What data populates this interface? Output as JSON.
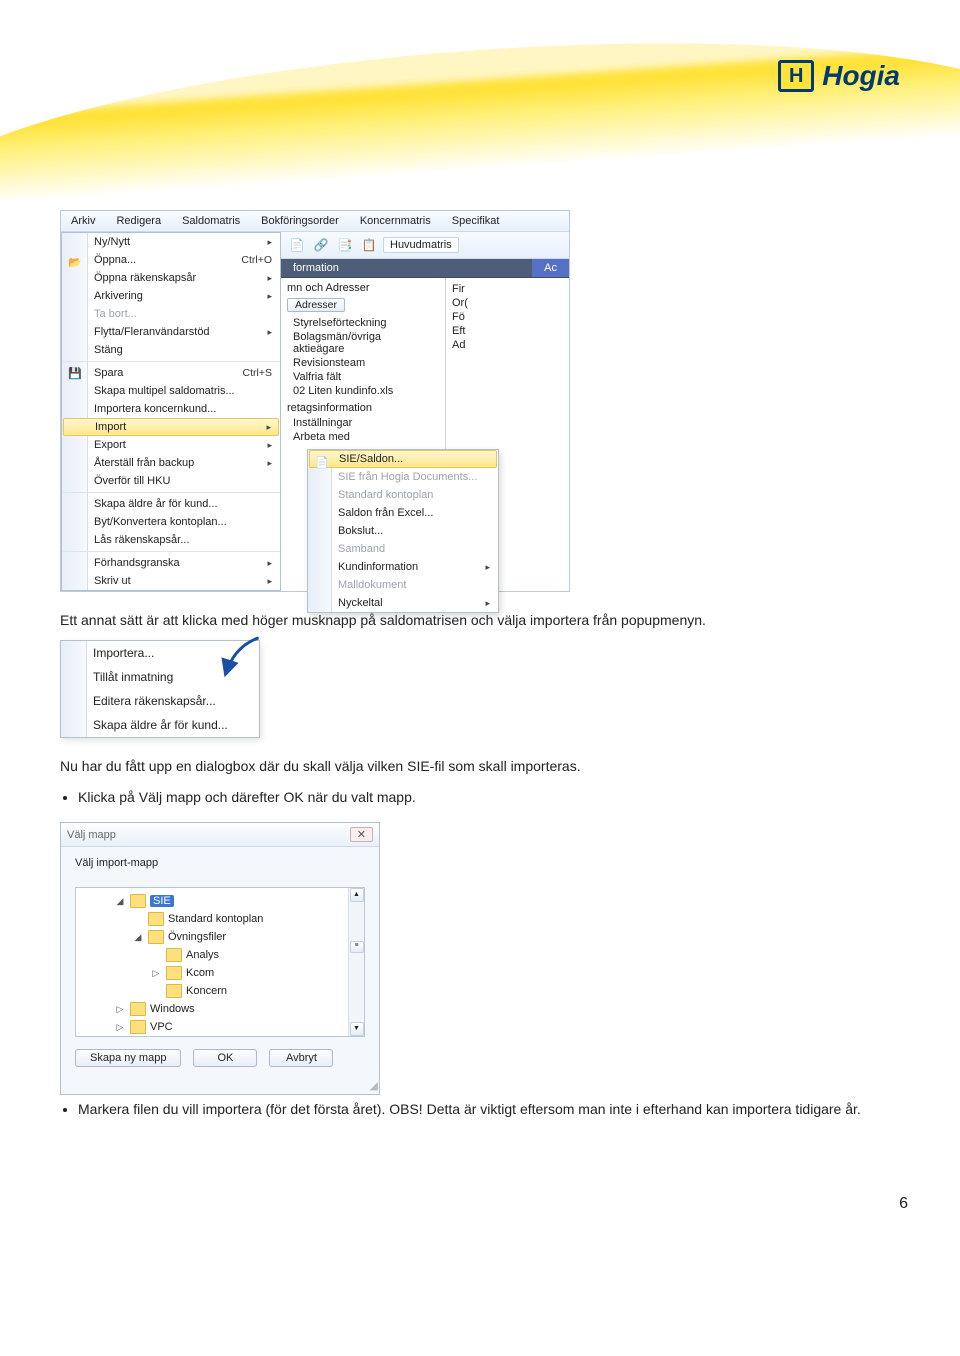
{
  "brand": {
    "name": "Hogia",
    "initial": "H"
  },
  "shot1": {
    "menubar": [
      "Arkiv",
      "Redigera",
      "Saldomatris",
      "Bokföringsorder",
      "Koncernmatris",
      "Specifikat"
    ],
    "menu": [
      {
        "label": "Ny/Nytt",
        "shortcut": "",
        "arrow": true,
        "icon": ""
      },
      {
        "label": "Öppna...",
        "shortcut": "Ctrl+O",
        "arrow": false,
        "icon": "📂"
      },
      {
        "label": "Öppna räkenskapsår",
        "shortcut": "",
        "arrow": true,
        "icon": ""
      },
      {
        "label": "Arkivering",
        "shortcut": "",
        "arrow": true,
        "icon": ""
      },
      {
        "label": "Ta bort...",
        "shortcut": "",
        "arrow": false,
        "icon": "",
        "disabled": true
      },
      {
        "label": "Flytta/Fleranvändarstöd",
        "shortcut": "",
        "arrow": true,
        "icon": ""
      },
      {
        "label": "Stäng",
        "shortcut": "",
        "arrow": false,
        "icon": ""
      },
      {
        "label": "Spara",
        "shortcut": "Ctrl+S",
        "arrow": false,
        "icon": "💾",
        "sep": true
      },
      {
        "label": "Skapa multipel saldomatris...",
        "shortcut": "",
        "arrow": false,
        "icon": ""
      },
      {
        "label": "Importera koncernkund...",
        "shortcut": "",
        "arrow": false,
        "icon": ""
      },
      {
        "label": "Import",
        "shortcut": "",
        "arrow": true,
        "icon": "",
        "hl": true,
        "sep": true
      },
      {
        "label": "Export",
        "shortcut": "",
        "arrow": true,
        "icon": ""
      },
      {
        "label": "Återställ från backup",
        "shortcut": "",
        "arrow": true,
        "icon": ""
      },
      {
        "label": "Överför till HKU",
        "shortcut": "",
        "arrow": false,
        "icon": ""
      },
      {
        "label": "Skapa äldre år för kund...",
        "shortcut": "",
        "arrow": false,
        "icon": "",
        "sep": true
      },
      {
        "label": "Byt/Konvertera kontoplan...",
        "shortcut": "",
        "arrow": false,
        "icon": ""
      },
      {
        "label": "Lås räkenskapsår...",
        "shortcut": "",
        "arrow": false,
        "icon": ""
      },
      {
        "label": "Förhandsgranska",
        "shortcut": "",
        "arrow": true,
        "icon": "",
        "sep": true
      },
      {
        "label": "Skriv ut",
        "shortcut": "",
        "arrow": true,
        "icon": ""
      }
    ],
    "toolbar_label": "Huvudmatris",
    "tabs": {
      "left": "formation",
      "right": "Ac"
    },
    "sublist_header": "mn och Adresser",
    "sublist_button": "Adresser",
    "sublist": [
      "Styrelseförteckning",
      "Bolagsmän/övriga aktieägare",
      "Revisionsteam",
      "Valfria fält",
      "02 Liten kundinfo.xls"
    ],
    "sublist2_header": "retagsinformation",
    "sublist2": [
      "Inställningar",
      "Arbeta med"
    ],
    "fields": [
      "Fir",
      "Or(",
      "Fö",
      "Eft",
      "Ad"
    ],
    "flyout": [
      {
        "label": "SIE/Saldon...",
        "hl": true,
        "icon": "📄",
        "arrow": false
      },
      {
        "label": "SIE från Hogia Documents...",
        "dis": true,
        "arrow": false
      },
      {
        "label": "Standard kontoplan",
        "dis": true,
        "arrow": false
      },
      {
        "label": "Saldon från Excel...",
        "arrow": false
      },
      {
        "label": "Bokslut...",
        "arrow": false
      },
      {
        "label": "Samband",
        "dis": true,
        "arrow": false
      },
      {
        "label": "Kundinformation",
        "arrow": true
      },
      {
        "label": "Malldokument",
        "dis": true,
        "arrow": false
      },
      {
        "label": "Nyckeltal",
        "arrow": true
      }
    ]
  },
  "para1": "Ett annat sätt är att klicka med höger musknapp på saldomatrisen och välja importera från popupmenyn.",
  "ctx": [
    "Importera...",
    "Tillåt inmatning",
    "Editera räkenskapsår...",
    "Skapa äldre år för kund..."
  ],
  "para2": "Nu har du fått upp en dialogbox där du skall välja vilken SIE-fil som skall importeras.",
  "bullet1_pre": "Klicka på ",
  "bullet1_em1": "Välj mapp",
  "bullet1_mid": " och därefter ",
  "bullet1_em2": "OK",
  "bullet1_post": " när du valt mapp.",
  "dlg": {
    "title": "Välj mapp",
    "subtitle": "Välj import-mapp",
    "tree": [
      {
        "indent": 1,
        "tw": "◢",
        "label": "SIE",
        "sel": true
      },
      {
        "indent": 2,
        "tw": "",
        "label": "Standard kontoplan"
      },
      {
        "indent": 2,
        "tw": "◢",
        "label": "Övningsfiler"
      },
      {
        "indent": 3,
        "tw": "",
        "label": "Analys"
      },
      {
        "indent": 3,
        "tw": "▷",
        "label": "Kcom"
      },
      {
        "indent": 3,
        "tw": "",
        "label": "Koncern"
      },
      {
        "indent": 1,
        "tw": "▷",
        "label": "Windows"
      },
      {
        "indent": 1,
        "tw": "▷",
        "label": "VPC"
      }
    ],
    "buttons": [
      "Skapa ny mapp",
      "OK",
      "Avbryt"
    ]
  },
  "bullet2_pre": "Markera filen du vill importera (för det första året). ",
  "bullet2_bold": "OBS!",
  "bullet2_post": " Detta är viktigt eftersom man inte i efterhand kan importera tidigare år.",
  "page_number": "6"
}
